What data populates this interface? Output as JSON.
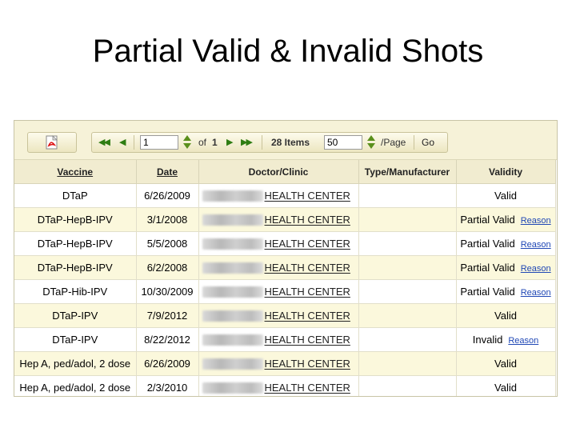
{
  "slide": {
    "title": "Partial Valid & Invalid Shots"
  },
  "toolbar": {
    "page_value": "1",
    "of_label": "of",
    "total_pages": "1",
    "items_label": "28 Items",
    "page_size_value": "50",
    "per_page_label": "/Page",
    "go_label": "Go",
    "first_label": "◀◀",
    "prev_label": "◀",
    "next_label": "▶",
    "last_label": "▶▶",
    "pdf_icon": "pdf-export-icon"
  },
  "table": {
    "headers": {
      "vaccine": "Vaccine",
      "date": "Date",
      "doctor": "Doctor/Clinic",
      "type": "Type/Manufacturer",
      "validity": "Validity"
    },
    "rows": [
      {
        "vaccine": "DTaP",
        "date": "6/26/2009",
        "clinic": "HEALTH CENTER",
        "type": "",
        "validity": "Valid",
        "reason": ""
      },
      {
        "vaccine": "DTaP-HepB-IPV",
        "date": "3/1/2008",
        "clinic": "HEALTH CENTER",
        "type": "",
        "validity": "Partial Valid",
        "reason": "Reason"
      },
      {
        "vaccine": "DTaP-HepB-IPV",
        "date": "5/5/2008",
        "clinic": "HEALTH CENTER",
        "type": "",
        "validity": "Partial Valid",
        "reason": "Reason"
      },
      {
        "vaccine": "DTaP-HepB-IPV",
        "date": "6/2/2008",
        "clinic": "HEALTH CENTER",
        "type": "",
        "validity": "Partial Valid",
        "reason": "Reason"
      },
      {
        "vaccine": "DTaP-Hib-IPV",
        "date": "10/30/2009",
        "clinic": "HEALTH CENTER",
        "type": "",
        "validity": "Partial Valid",
        "reason": "Reason"
      },
      {
        "vaccine": "DTaP-IPV",
        "date": "7/9/2012",
        "clinic": "HEALTH CENTER",
        "type": "",
        "validity": "Valid",
        "reason": ""
      },
      {
        "vaccine": "DTaP-IPV",
        "date": "8/22/2012",
        "clinic": "HEALTH CENTER",
        "type": "",
        "validity": "Invalid",
        "reason": "Reason"
      },
      {
        "vaccine": "Hep A, ped/adol, 2 dose",
        "date": "6/26/2009",
        "clinic": "HEALTH CENTER",
        "type": "",
        "validity": "Valid",
        "reason": ""
      },
      {
        "vaccine": "Hep A, ped/adol, 2 dose",
        "date": "2/3/2010",
        "clinic": "HEALTH CENTER",
        "type": "",
        "validity": "Valid",
        "reason": ""
      }
    ]
  }
}
